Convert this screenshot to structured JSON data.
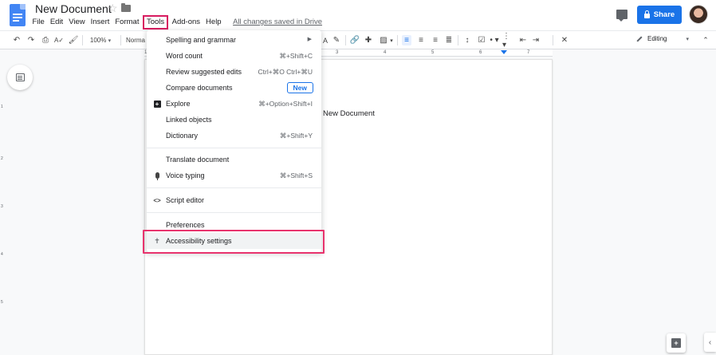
{
  "app": {
    "doc_title": "New Document",
    "saved_status": "All changes saved in Drive"
  },
  "menubar": {
    "items": [
      "File",
      "Edit",
      "View",
      "Insert",
      "Format",
      "Tools",
      "Add-ons",
      "Help"
    ],
    "active": "Tools"
  },
  "header": {
    "share_label": "Share"
  },
  "toolbar": {
    "zoom": "100%",
    "style": "Normal",
    "mode": "Editing"
  },
  "document": {
    "body_text": "New Document"
  },
  "ruler": {
    "marks": [
      "1",
      "2",
      "3",
      "4",
      "5",
      "6",
      "7"
    ]
  },
  "vertical_ruler": {
    "marks": [
      "1",
      "2",
      "3",
      "4",
      "5"
    ]
  },
  "tools_menu": {
    "items": [
      {
        "label": "Spelling and grammar",
        "shortcut": "",
        "submenu": true
      },
      {
        "label": "Word count",
        "shortcut": "⌘+Shift+C"
      },
      {
        "label": "Review suggested edits",
        "shortcut": "Ctrl+⌘O Ctrl+⌘U"
      },
      {
        "label": "Compare documents",
        "badge": "New"
      },
      {
        "label": "Explore",
        "shortcut": "⌘+Option+Shift+I",
        "icon": "explore-icon"
      },
      {
        "label": "Linked objects",
        "shortcut": ""
      },
      {
        "label": "Dictionary",
        "shortcut": "⌘+Shift+Y"
      },
      {
        "label": "Translate document",
        "shortcut": ""
      },
      {
        "label": "Voice typing",
        "shortcut": "⌘+Shift+S",
        "icon": "microphone-icon"
      },
      {
        "label": "Script editor",
        "shortcut": "",
        "icon": "code-icon"
      },
      {
        "label": "Preferences",
        "shortcut": ""
      },
      {
        "label": "Accessibility settings",
        "shortcut": "",
        "icon": "accessibility-icon",
        "highlighted": true
      }
    ]
  },
  "colors": {
    "accent": "#1a73e8",
    "highlight": "#e8336d"
  }
}
